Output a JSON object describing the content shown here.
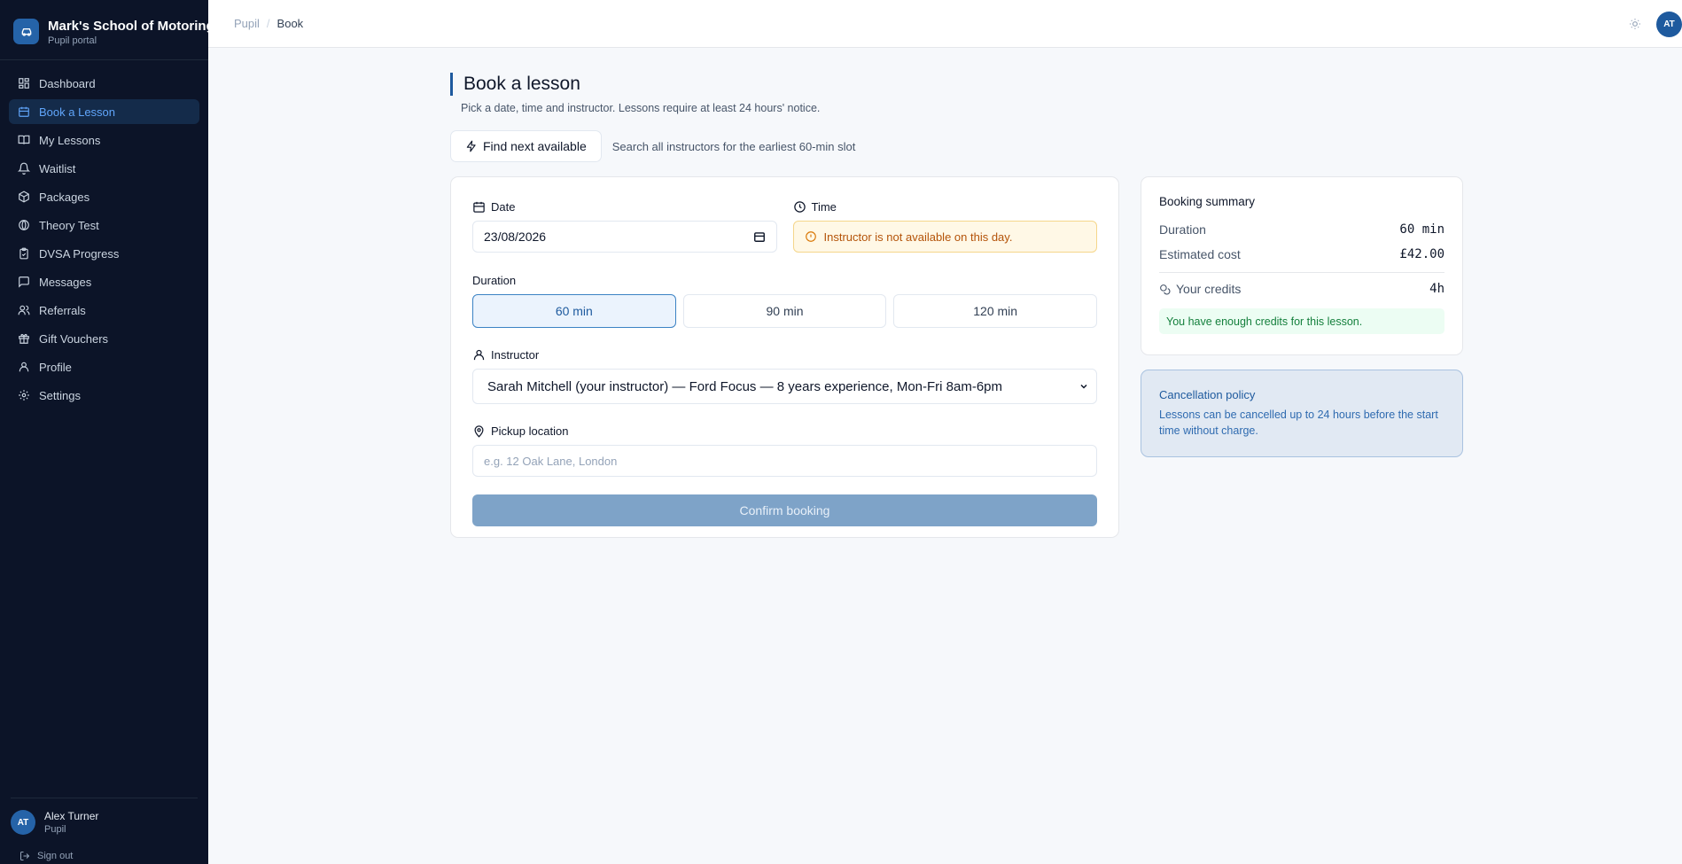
{
  "brand": {
    "title": "Mark's School of Motoring",
    "subtitle": "Pupil portal"
  },
  "sidebar": {
    "items": [
      {
        "label": "Dashboard",
        "icon": "dashboard-icon"
      },
      {
        "label": "Book a Lesson",
        "icon": "calendar-icon",
        "active": true
      },
      {
        "label": "My Lessons",
        "icon": "book-icon"
      },
      {
        "label": "Waitlist",
        "icon": "bell-icon"
      },
      {
        "label": "Packages",
        "icon": "package-icon"
      },
      {
        "label": "Theory Test",
        "icon": "globe-icon"
      },
      {
        "label": "DVSA Progress",
        "icon": "clipboard-icon"
      },
      {
        "label": "Messages",
        "icon": "message-icon"
      },
      {
        "label": "Referrals",
        "icon": "users-icon"
      },
      {
        "label": "Gift Vouchers",
        "icon": "gift-icon"
      },
      {
        "label": "Profile",
        "icon": "user-icon"
      },
      {
        "label": "Settings",
        "icon": "gear-icon"
      }
    ],
    "user": {
      "initials": "AT",
      "name": "Alex Turner",
      "role": "Pupil"
    },
    "signout": "Sign out"
  },
  "header": {
    "breadcrumb": [
      "Pupil",
      "Book"
    ],
    "avatar_initials": "AT"
  },
  "page": {
    "title": "Book a lesson",
    "subtitle": "Pick a date, time and instructor. Lessons require at least 24 hours' notice.",
    "find_next_label": "Find next available",
    "find_next_desc": "Search all instructors for the earliest 60-min slot"
  },
  "form": {
    "date_label": "Date",
    "date_value": "23/08/2026",
    "time_label": "Time",
    "time_warning": "Instructor is not available on this day.",
    "duration_label": "Duration",
    "durations": [
      "60 min",
      "90 min",
      "120 min"
    ],
    "selected_duration": "60 min",
    "instructor_label": "Instructor",
    "instructor_value": "Sarah Mitchell (your instructor) — Ford Focus — 8 years experience, Mon-Fri 8am-6pm",
    "pickup_label": "Pickup location",
    "pickup_placeholder": "e.g. 12 Oak Lane, London",
    "confirm_label": "Confirm booking"
  },
  "summary": {
    "title": "Booking summary",
    "duration_label": "Duration",
    "duration_value": "60 min",
    "cost_label": "Estimated cost",
    "cost_value": "£42.00",
    "credits_label": "Your credits",
    "credits_value": "4h",
    "credits_message": "You have enough credits for this lesson."
  },
  "policy": {
    "title": "Cancellation policy",
    "text": "Lessons can be cancelled up to 24 hours before the start time without charge."
  },
  "colors": {
    "sidebar_bg": "#0c1428",
    "accent": "#1e5a9e",
    "warning_bg": "#fff8e6",
    "success_text": "#15803d"
  }
}
